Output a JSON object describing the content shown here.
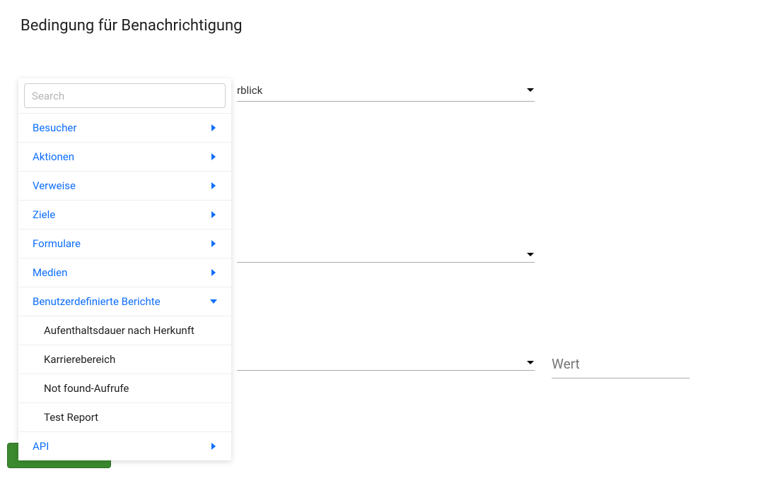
{
  "title": "Bedingung für Benachrichtigung",
  "search": {
    "placeholder": "Search"
  },
  "menu": {
    "items": [
      {
        "label": "Besucher"
      },
      {
        "label": "Aktionen"
      },
      {
        "label": "Verweise"
      },
      {
        "label": "Ziele"
      },
      {
        "label": "Formulare"
      },
      {
        "label": "Medien"
      },
      {
        "label": "Benutzerdefinierte Berichte"
      }
    ],
    "subitems": [
      {
        "label": "Aufenthaltsdauer nach Herkunft"
      },
      {
        "label": "Karrierebereich"
      },
      {
        "label": "Not found-Aufrufe"
      },
      {
        "label": "Test Report"
      }
    ],
    "api": {
      "label": "API"
    }
  },
  "select1": {
    "visible_text": "rblick"
  },
  "select2": {
    "visible_text": ""
  },
  "select3": {
    "visible_text": ""
  },
  "wert": {
    "placeholder": "Wert"
  }
}
